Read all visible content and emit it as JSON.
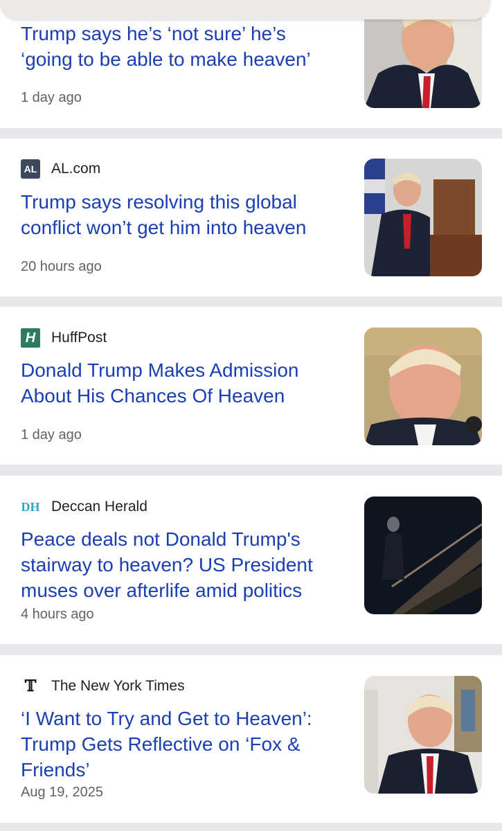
{
  "articles": [
    {
      "source": "",
      "headline_line1": "Trump says he’s ‘not sure’ he’s",
      "headline_line2": "‘going to be able to make heaven’",
      "headline_line3": "",
      "time": "1 day ago"
    },
    {
      "source": "AL.com",
      "logo_text": "AL",
      "headline_line1": "Trump says resolving this global",
      "headline_line2": "conflict won’t get him into heaven",
      "headline_line3": "",
      "time": "20 hours ago"
    },
    {
      "source": "HuffPost",
      "logo_text": "H",
      "headline_line1": "Donald Trump Makes Admission",
      "headline_line2": "About His Chances Of Heaven",
      "headline_line3": "",
      "time": "1 day ago"
    },
    {
      "source": "Deccan Herald",
      "logo_text": "DH",
      "headline_line1": "Peace deals not Donald Trump's",
      "headline_line2": "stairway to heaven? US President",
      "headline_line3": "muses over afterlife amid politics",
      "time": "4 hours ago"
    },
    {
      "source": "The New York Times",
      "logo_text": "𝕋",
      "headline_line1": "‘I Want to Try and Get to Heaven’:",
      "headline_line2": "Trump Gets Reflective on ‘Fox &",
      "headline_line3": "Friends’",
      "time": "Aug 19, 2025"
    }
  ],
  "colors": {
    "headline": "#1a3fb4",
    "background": "#e8e8ec",
    "card": "#ffffff",
    "huffpost_logo": "#2e7a63",
    "deccan_logo": "#2fa7c9",
    "al_logo": "#3a4a5c"
  }
}
